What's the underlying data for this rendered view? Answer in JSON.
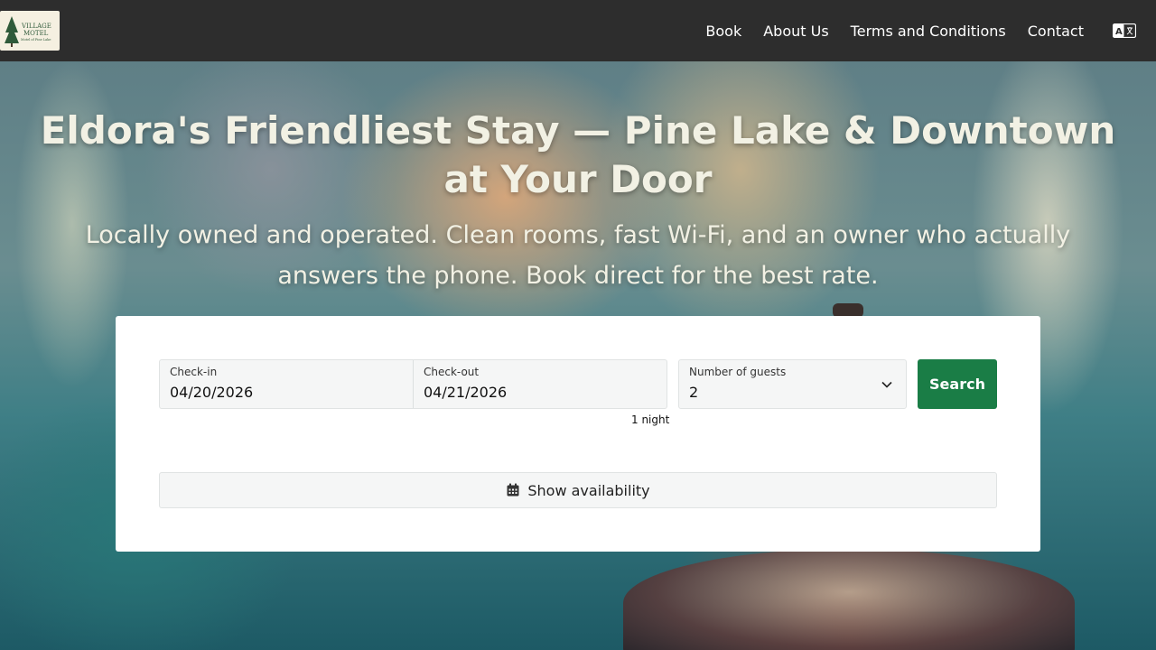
{
  "nav": {
    "logo_text": "VILLAGE MOTEL",
    "logo_subtext": "Motel of Pine Lake",
    "links": [
      "Book",
      "About Us",
      "Terms and Conditions",
      "Contact"
    ],
    "language_icon": "language-icon"
  },
  "hero": {
    "headline": "Eldora's Friendliest Stay — Pine Lake & Downtown at Your Door",
    "subline": "Locally owned and operated. Clean rooms, fast Wi-Fi, and an owner who actually answers the phone. Book direct for the best rate."
  },
  "booking": {
    "checkin_label": "Check-in",
    "checkin_value": "04/20/2026",
    "checkout_label": "Check-out",
    "checkout_value": "04/21/2026",
    "nights": "1 night",
    "guests_label": "Number of guests",
    "guests_value": "2",
    "search_label": "Search",
    "availability_label": "Show availability",
    "availability_icon": "calendar-icon"
  },
  "colors": {
    "nav_bg": "#2d2d2d",
    "search_button": "#1a7d46",
    "hero_text": "#f2f1e4"
  }
}
